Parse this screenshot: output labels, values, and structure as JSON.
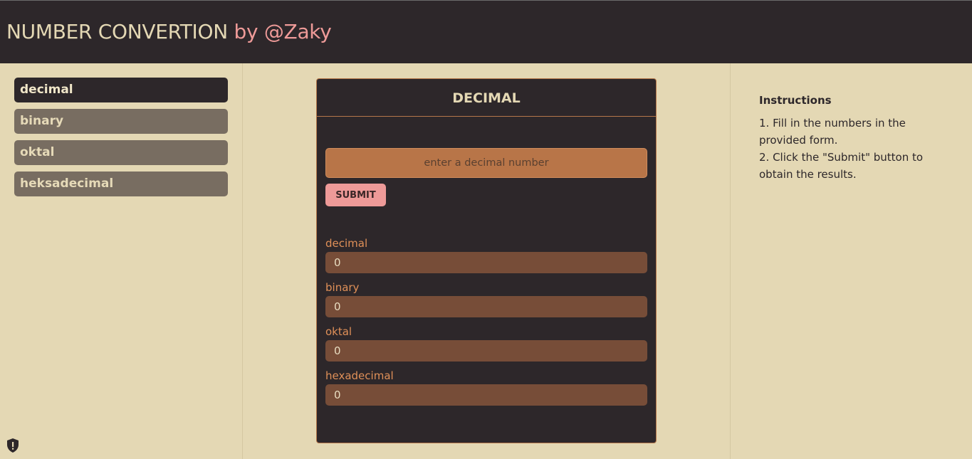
{
  "header": {
    "title": "NUMBER CONVERTION",
    "byline": "by @Zaky"
  },
  "sidebar": {
    "items": [
      {
        "label": "decimal",
        "active": true
      },
      {
        "label": "binary",
        "active": false
      },
      {
        "label": "oktal",
        "active": false
      },
      {
        "label": "heksadecimal",
        "active": false
      }
    ],
    "shield_icon": "shield-alert-icon"
  },
  "converter": {
    "title": "DECIMAL",
    "input": {
      "value": "",
      "placeholder": "enter a decimal number"
    },
    "submit_label": "SUBMIT",
    "results": [
      {
        "label": "decimal",
        "value": "0"
      },
      {
        "label": "binary",
        "value": "0"
      },
      {
        "label": "oktal",
        "value": "0"
      },
      {
        "label": "hexadecimal",
        "value": "0"
      }
    ]
  },
  "instructions": {
    "title": "Instructions",
    "steps": [
      "1. Fill in the numbers in the provided form.",
      "2. Click the \"Submit\" button to obtain the results."
    ]
  },
  "colors": {
    "header_bg": "#2d272a",
    "page_bg": "#e4d8b4",
    "accent_pink": "#ee9a98",
    "accent_orange": "#b87548",
    "result_bg": "#774d38"
  }
}
